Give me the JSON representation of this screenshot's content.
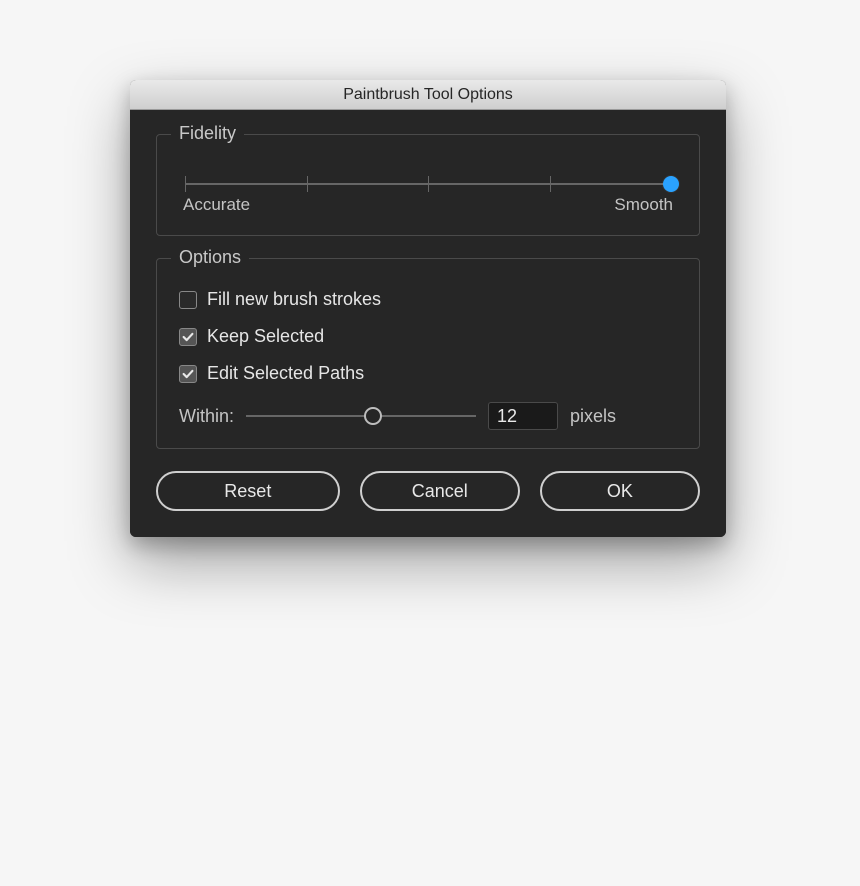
{
  "dialog": {
    "title": "Paintbrush Tool Options"
  },
  "fidelity": {
    "legend": "Fidelity",
    "left_label": "Accurate",
    "right_label": "Smooth",
    "value_percent": 100,
    "tick_count": 5
  },
  "options": {
    "legend": "Options",
    "fill_new_brush_strokes": {
      "label": "Fill new brush strokes",
      "checked": false
    },
    "keep_selected": {
      "label": "Keep Selected",
      "checked": true
    },
    "edit_selected_paths": {
      "label": "Edit Selected Paths",
      "checked": true
    },
    "within": {
      "label": "Within:",
      "value": "12",
      "unit": "pixels",
      "percent": 55
    }
  },
  "buttons": {
    "reset": "Reset",
    "cancel": "Cancel",
    "ok": "OK"
  },
  "colors": {
    "accent": "#2aa2ff"
  }
}
